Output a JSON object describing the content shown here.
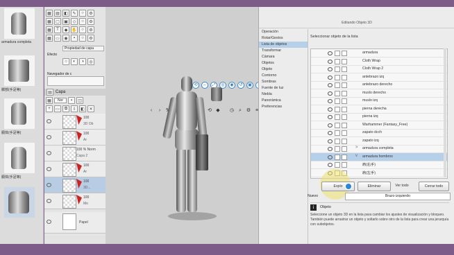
{
  "materials": [
    {
      "label": "armadura completa"
    },
    {
      "label": "脚部(手足等)"
    },
    {
      "label": "胴体(手足等)"
    },
    {
      "label": "胴体(手足等)"
    },
    {
      "label": ""
    }
  ],
  "palette": {
    "subpanel_title": "Propiedad de capa",
    "effect_label": "Efecto",
    "navigator_label": "Navegador de c",
    "layer_tab": "Capa",
    "blend_mode": "Nor",
    "layers": [
      {
        "name": "100",
        "sub": "3D Ob"
      },
      {
        "name": "100",
        "sub": "Ar"
      },
      {
        "name": "100 % Norm",
        "sub": "Capa 2"
      },
      {
        "name": "100",
        "sub": "Ar"
      },
      {
        "name": "100",
        "sub": "3D..."
      },
      {
        "name": "100",
        "sub": "Mo"
      },
      {
        "name": "Papel",
        "sub": ""
      }
    ]
  },
  "right_panel": {
    "title": "Editando Objeto 3D",
    "categories": [
      "Operación",
      "Rotar/Gestos",
      "Lista de objetos",
      "Transformar",
      "Cámara",
      "Objetos",
      "Objeto",
      "Contorno",
      "Sombras",
      "Fuente de luz",
      "Niebla",
      "Panorámica",
      "Preferencias"
    ],
    "selected_category": 2,
    "select_label": "Seleccionar objeto de la lista",
    "objects": [
      {
        "name": "armadura",
        "arrow": ""
      },
      {
        "name": "Cloth Wrap",
        "arrow": ""
      },
      {
        "name": "Cloth Wrap 2",
        "arrow": ""
      },
      {
        "name": "antebrazo izq",
        "arrow": ""
      },
      {
        "name": "antebrazo derecho",
        "arrow": ""
      },
      {
        "name": "muslo derecho",
        "arrow": ""
      },
      {
        "name": "muslo izq",
        "arrow": ""
      },
      {
        "name": "pierna derecha",
        "arrow": ""
      },
      {
        "name": "pierna izq",
        "arrow": ""
      },
      {
        "name": "Warhammer (Fantasy_Free)",
        "arrow": ""
      },
      {
        "name": "zapato dcch",
        "arrow": ""
      },
      {
        "name": "zapato izq",
        "arrow": ""
      },
      {
        "name": "armadura completa",
        "arrow": ">"
      },
      {
        "name": "armadura hombros",
        "arrow": "v"
      },
      {
        "name": "肩(右手)",
        "arrow": ""
      },
      {
        "name": "肩(左手)",
        "arrow": ""
      }
    ],
    "selected_object": 13,
    "buttons": {
      "explode": "Explo",
      "delete": "Eliminar",
      "add": "Ver todo",
      "close_all": "Cerrar todo"
    },
    "new_label": "Nuevo",
    "new_select_value": "Brazo izquierdo",
    "info_title": "Objeto",
    "info_text": "Seleccione un objeto 3D en la lista para cambiar los ajustes de visualización y bloqueo. También puede arrastrar un objeto y soltarlo sobre otro de la lista para crear una jerarquía con subobjetos."
  },
  "canvas": {
    "toolbar_icons": [
      "move-icon",
      "rotate-icon",
      "pan-icon",
      "scale-icon",
      "camera-icon",
      "view-icon",
      "reset-icon",
      "fit-icon",
      "menu-icon"
    ]
  }
}
